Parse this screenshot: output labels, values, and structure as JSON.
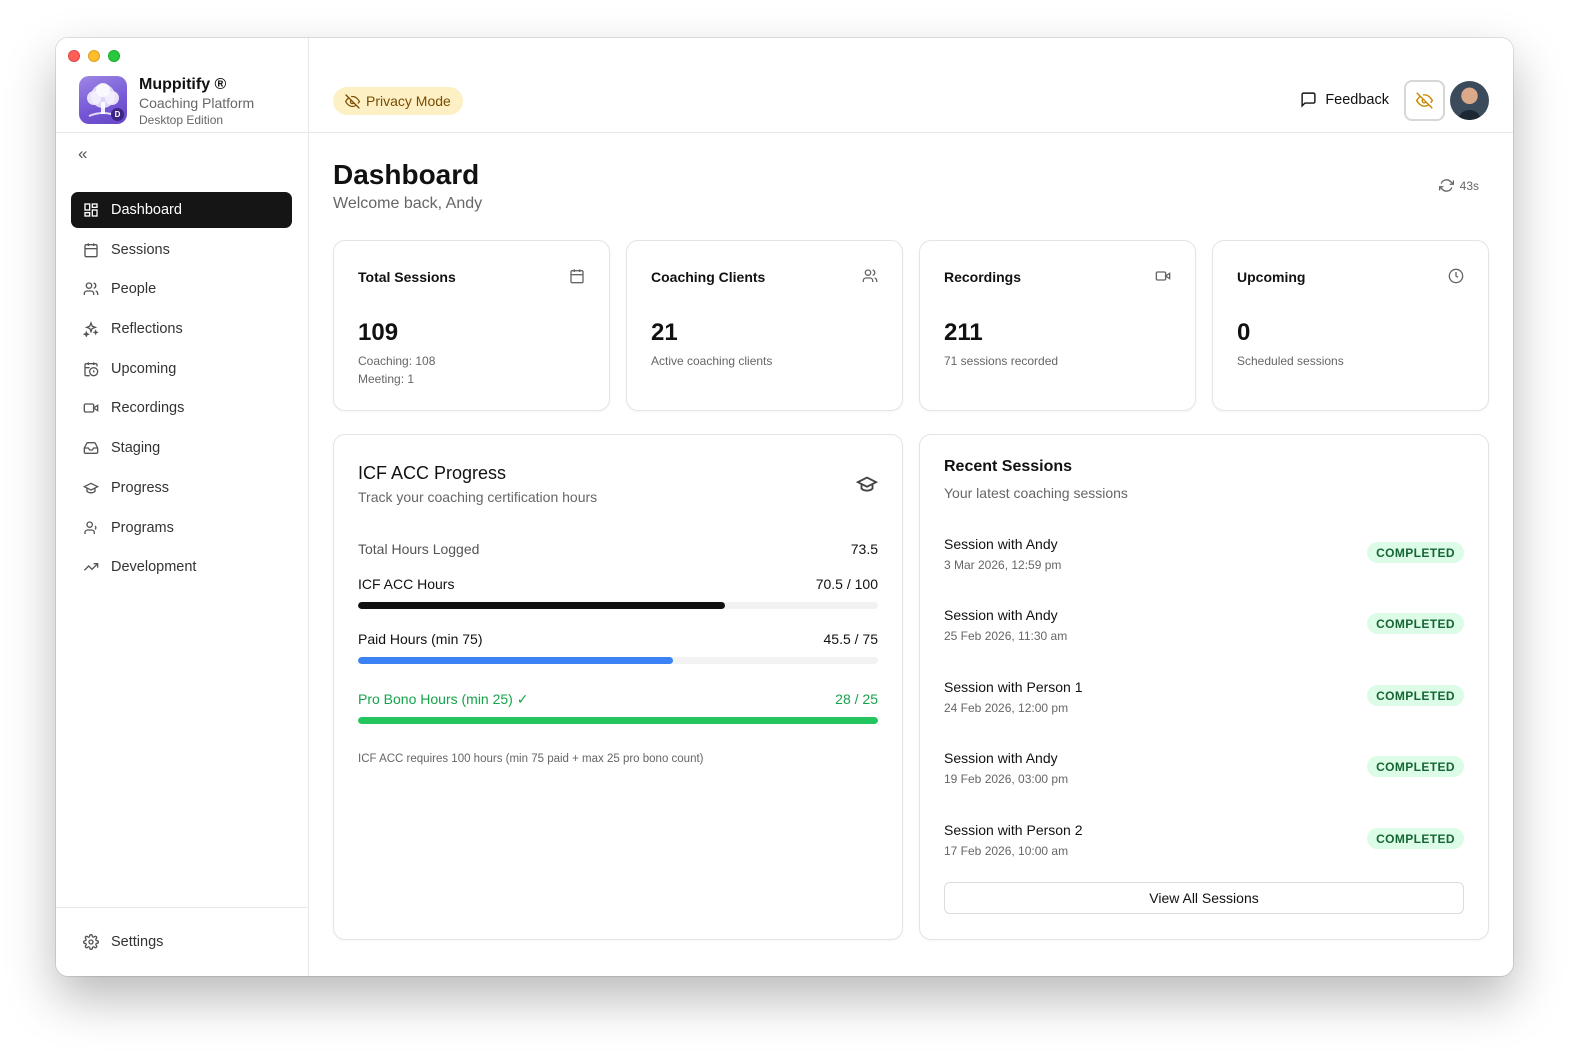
{
  "app": {
    "name": "Muppitify ®",
    "subtitle": "Coaching Platform",
    "edition": "Desktop Edition",
    "icon_badge": "D"
  },
  "sidebar": {
    "collapse_icon": "chevrons-left-icon",
    "items": [
      {
        "label": "Dashboard",
        "icon": "layout-grid-icon",
        "active": true
      },
      {
        "label": "Sessions",
        "icon": "calendar-icon"
      },
      {
        "label": "People",
        "icon": "users-icon"
      },
      {
        "label": "Reflections",
        "icon": "sparkles-icon"
      },
      {
        "label": "Upcoming",
        "icon": "calendar-clock-icon"
      },
      {
        "label": "Recordings",
        "icon": "video-icon"
      },
      {
        "label": "Staging",
        "icon": "inbox-icon"
      },
      {
        "label": "Progress",
        "icon": "graduation-cap-icon"
      },
      {
        "label": "Programs",
        "icon": "user-check-icon"
      },
      {
        "label": "Development",
        "icon": "trending-up-icon"
      }
    ],
    "settings_label": "Settings"
  },
  "header": {
    "privacy_label": "Privacy Mode",
    "feedback_label": "Feedback"
  },
  "page": {
    "title": "Dashboard",
    "welcome": "Welcome back, Andy",
    "refresh_timer": "43s"
  },
  "stats": [
    {
      "label": "Total Sessions",
      "value": "109",
      "note1": "Coaching: 108",
      "note2": "Meeting: 1",
      "icon": "calendar-icon"
    },
    {
      "label": "Coaching Clients",
      "value": "21",
      "note1": "Active coaching clients",
      "icon": "users-icon"
    },
    {
      "label": "Recordings",
      "value": "211",
      "note1": "71 sessions recorded",
      "icon": "video-icon"
    },
    {
      "label": "Upcoming",
      "value": "0",
      "note1": "Scheduled sessions",
      "icon": "clock-icon"
    }
  ],
  "icf": {
    "title": "ICF ACC Progress",
    "subtitle": "Track your coaching certification hours",
    "total_label": "Total Hours Logged",
    "total_value": "73.5",
    "bars": [
      {
        "label": "ICF ACC Hours",
        "value": "70.5 / 100",
        "fraction": 0.705,
        "color": "#111111"
      },
      {
        "label": "Paid Hours (min 75)",
        "value": "45.5 / 75",
        "fraction": 0.6067,
        "color": "#3b82f6"
      },
      {
        "label": "Pro Bono Hours (min 25) ✓",
        "value": "28 / 25",
        "fraction": 1.0,
        "color": "#22c55e"
      }
    ],
    "footnote": "ICF ACC requires 100 hours (min 75 paid + max 25 pro bono count)"
  },
  "recent": {
    "title": "Recent Sessions",
    "subtitle": "Your latest coaching sessions",
    "sessions": [
      {
        "title": "Session with Andy",
        "date": "3 Mar 2026, 12:59 pm",
        "status": "COMPLETED"
      },
      {
        "title": "Session with Andy",
        "date": "25 Feb 2026, 11:30 am",
        "status": "COMPLETED"
      },
      {
        "title": "Session with Person 1",
        "date": "24 Feb 2026, 12:00 pm",
        "status": "COMPLETED"
      },
      {
        "title": "Session with Andy",
        "date": "19 Feb 2026, 03:00 pm",
        "status": "COMPLETED"
      },
      {
        "title": "Session with Person 2",
        "date": "17 Feb 2026, 10:00 am",
        "status": "COMPLETED"
      }
    ],
    "view_all_label": "View All Sessions"
  }
}
